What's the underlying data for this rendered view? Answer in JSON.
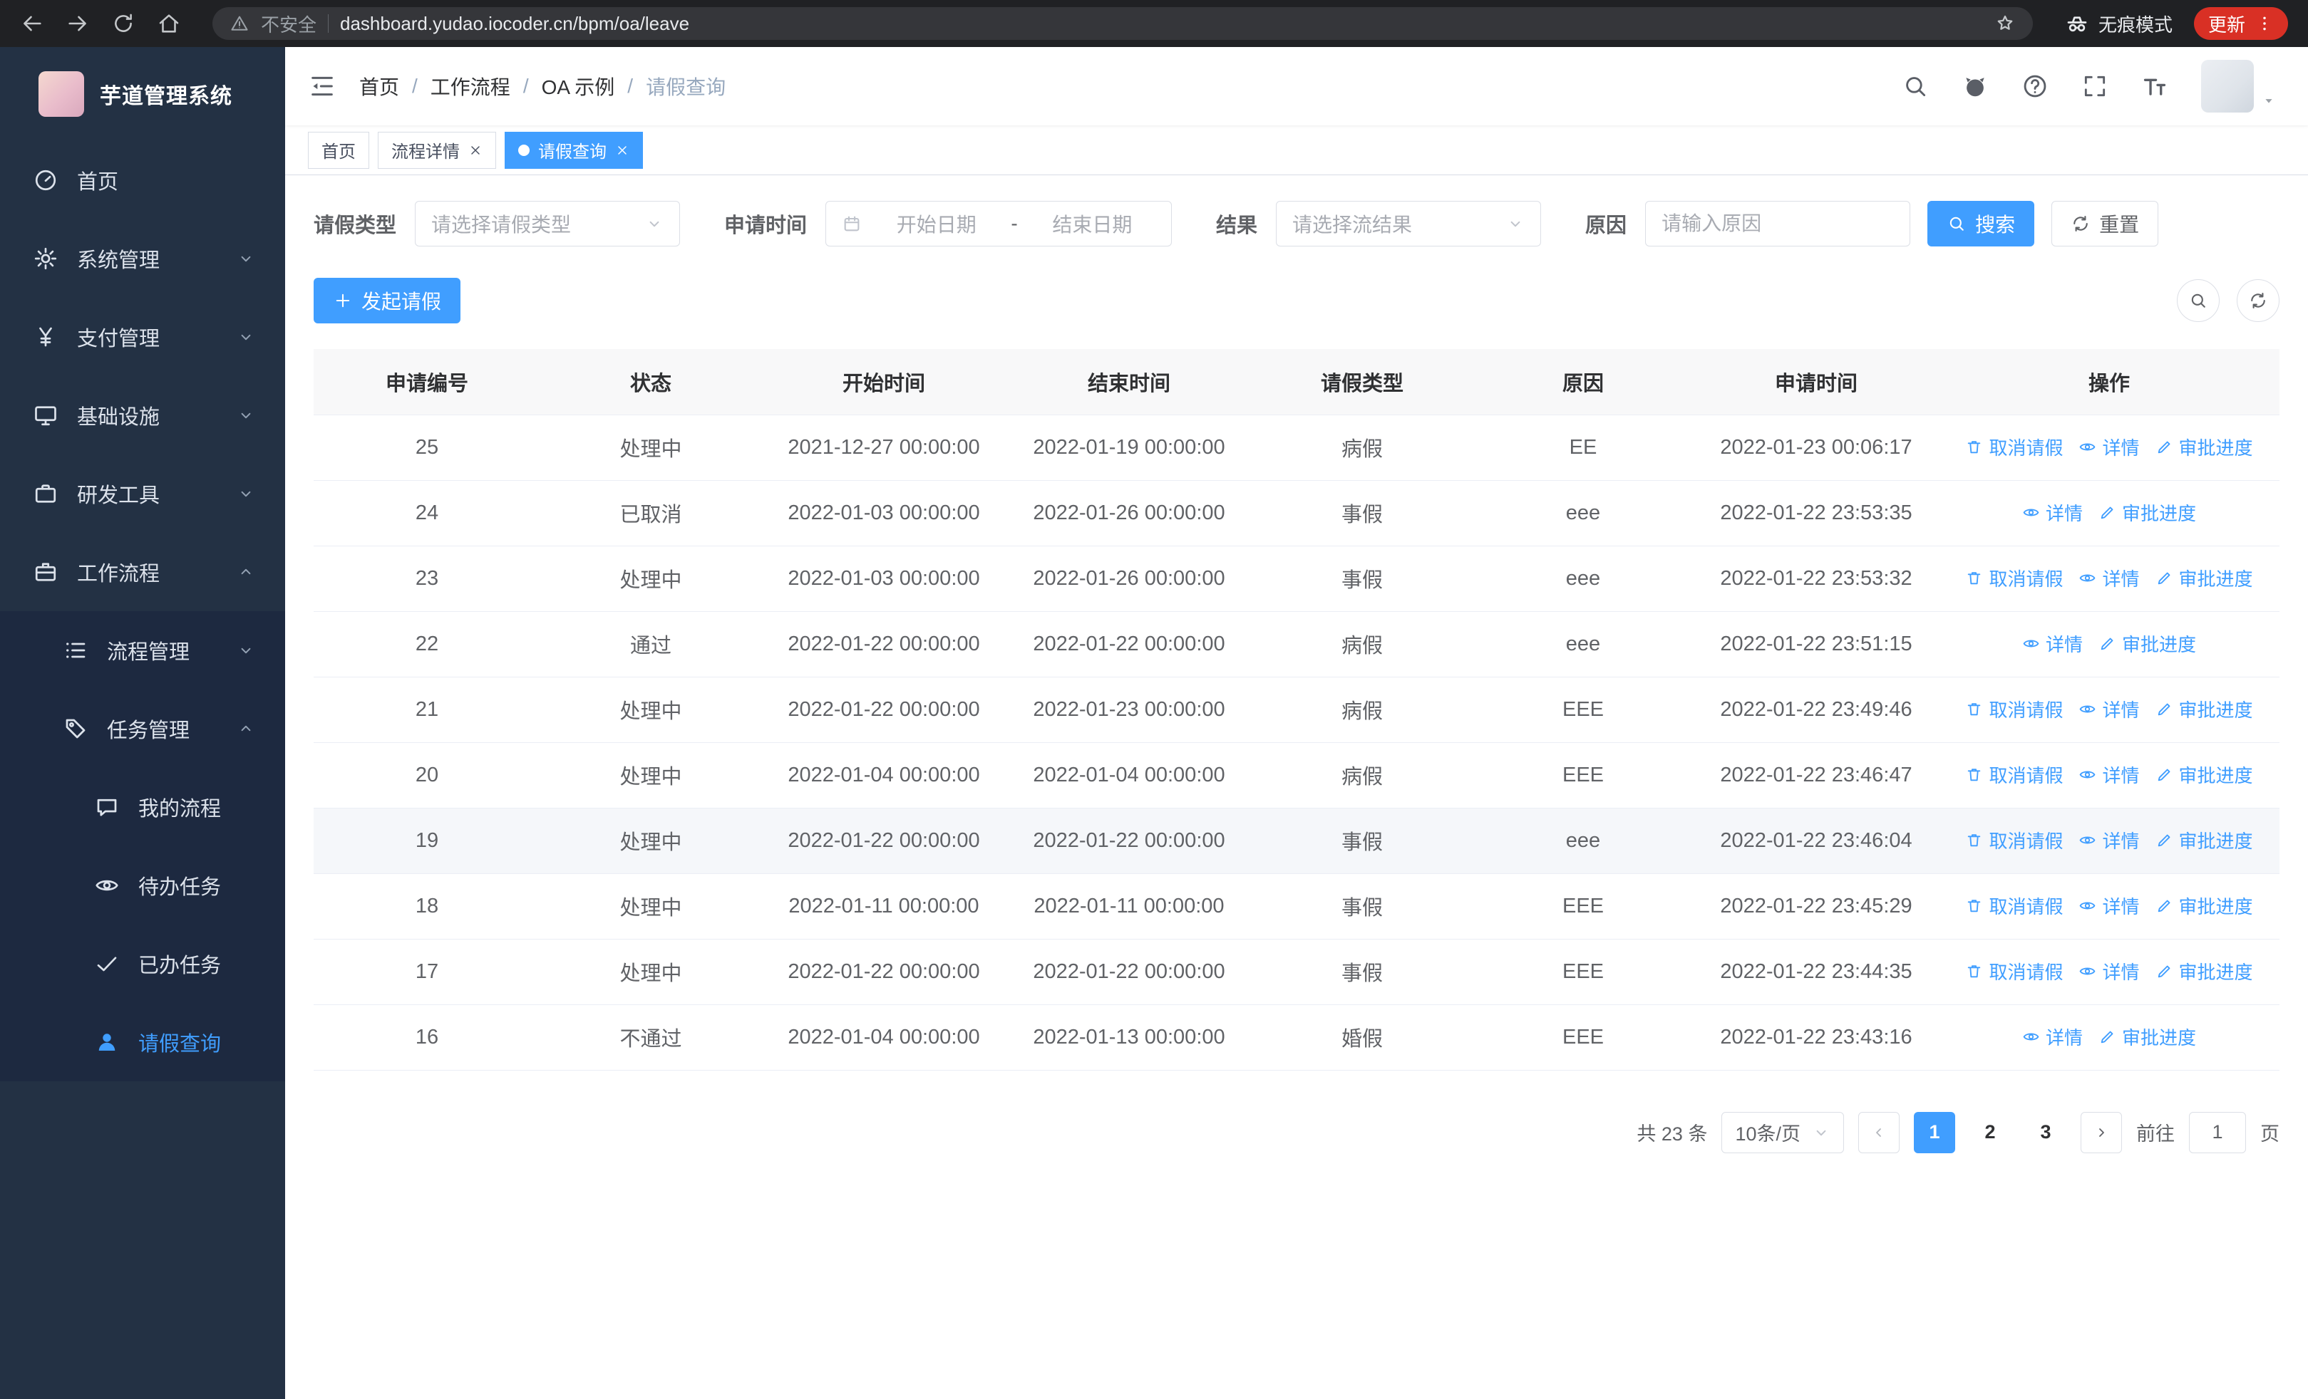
{
  "browser": {
    "security_warning": "不安全",
    "url": "dashboard.yudao.iocoder.cn/bpm/oa/leave",
    "incognito_label": "无痕模式",
    "update_label": "更新"
  },
  "sidebar": {
    "logo_title": "芋道管理系统",
    "items": [
      {
        "icon": "dashboard-icon",
        "label": "首页"
      },
      {
        "icon": "gear-icon",
        "label": "系统管理"
      },
      {
        "icon": "yen-icon",
        "label": "支付管理"
      },
      {
        "icon": "infrastructure-icon",
        "label": "基础设施"
      },
      {
        "icon": "tools-icon",
        "label": "研发工具"
      },
      {
        "icon": "workflow-icon",
        "label": "工作流程"
      }
    ],
    "sub_items": [
      {
        "icon": "process-list-icon",
        "label": "流程管理"
      },
      {
        "icon": "task-tag-icon",
        "label": "任务管理"
      },
      {
        "icon": "chat-icon",
        "label": "我的流程"
      },
      {
        "icon": "eye-icon",
        "label": "待办任务"
      },
      {
        "icon": "check-icon",
        "label": "已办任务"
      },
      {
        "icon": "user-icon",
        "label": "请假查询"
      }
    ]
  },
  "header": {
    "breadcrumb": [
      "首页",
      "工作流程",
      "OA 示例",
      "请假查询"
    ],
    "breadcrumb_separator": "/"
  },
  "tabs": [
    {
      "label": "首页"
    },
    {
      "label": "流程详情"
    },
    {
      "label": "请假查询"
    }
  ],
  "filters": {
    "leave_type_label": "请假类型",
    "leave_type_placeholder": "请选择请假类型",
    "apply_time_label": "申请时间",
    "start_date_placeholder": "开始日期",
    "range_separator": "-",
    "end_date_placeholder": "结束日期",
    "result_label": "结果",
    "result_placeholder": "请选择流结果",
    "reason_label": "原因",
    "reason_placeholder": "请输入原因",
    "search_button": "搜索",
    "reset_button": "重置"
  },
  "toolbar": {
    "create_button": "发起请假"
  },
  "table": {
    "columns": [
      "申请编号",
      "状态",
      "开始时间",
      "结束时间",
      "请假类型",
      "原因",
      "申请时间",
      "操作"
    ],
    "action_labels": {
      "cancel": "取消请假",
      "detail": "详情",
      "progress": "审批进度"
    },
    "rows": [
      {
        "id": "25",
        "status": "处理中",
        "start": "2021-12-27 00:00:00",
        "end": "2022-01-19 00:00:00",
        "type": "病假",
        "reason": "EE",
        "apply_time": "2022-01-23 00:06:17"
      },
      {
        "id": "24",
        "status": "已取消",
        "start": "2022-01-03 00:00:00",
        "end": "2022-01-26 00:00:00",
        "type": "事假",
        "reason": "eee",
        "apply_time": "2022-01-22 23:53:35"
      },
      {
        "id": "23",
        "status": "处理中",
        "start": "2022-01-03 00:00:00",
        "end": "2022-01-26 00:00:00",
        "type": "事假",
        "reason": "eee",
        "apply_time": "2022-01-22 23:53:32"
      },
      {
        "id": "22",
        "status": "通过",
        "start": "2022-01-22 00:00:00",
        "end": "2022-01-22 00:00:00",
        "type": "病假",
        "reason": "eee",
        "apply_time": "2022-01-22 23:51:15"
      },
      {
        "id": "21",
        "status": "处理中",
        "start": "2022-01-22 00:00:00",
        "end": "2022-01-23 00:00:00",
        "type": "病假",
        "reason": "EEE",
        "apply_time": "2022-01-22 23:49:46"
      },
      {
        "id": "20",
        "status": "处理中",
        "start": "2022-01-04 00:00:00",
        "end": "2022-01-04 00:00:00",
        "type": "病假",
        "reason": "EEE",
        "apply_time": "2022-01-22 23:46:47"
      },
      {
        "id": "19",
        "status": "处理中",
        "start": "2022-01-22 00:00:00",
        "end": "2022-01-22 00:00:00",
        "type": "事假",
        "reason": "eee",
        "apply_time": "2022-01-22 23:46:04"
      },
      {
        "id": "18",
        "status": "处理中",
        "start": "2022-01-11 00:00:00",
        "end": "2022-01-11 00:00:00",
        "type": "事假",
        "reason": "EEE",
        "apply_time": "2022-01-22 23:45:29"
      },
      {
        "id": "17",
        "status": "处理中",
        "start": "2022-01-22 00:00:00",
        "end": "2022-01-22 00:00:00",
        "type": "事假",
        "reason": "EEE",
        "apply_time": "2022-01-22 23:44:35"
      },
      {
        "id": "16",
        "status": "不通过",
        "start": "2022-01-04 00:00:00",
        "end": "2022-01-13 00:00:00",
        "type": "婚假",
        "reason": "EEE",
        "apply_time": "2022-01-22 23:43:16"
      }
    ]
  },
  "pagination": {
    "total": "共 23 条",
    "page_size": "10条/页",
    "pages": [
      "1",
      "2",
      "3"
    ],
    "goto_label": "前往",
    "goto_value": "1",
    "page_unit": "页"
  },
  "colors": {
    "primary": "#409eff",
    "sidebar_bg": "#233144",
    "browser_bar_bg": "#202124",
    "update_pill": "#d93025"
  }
}
